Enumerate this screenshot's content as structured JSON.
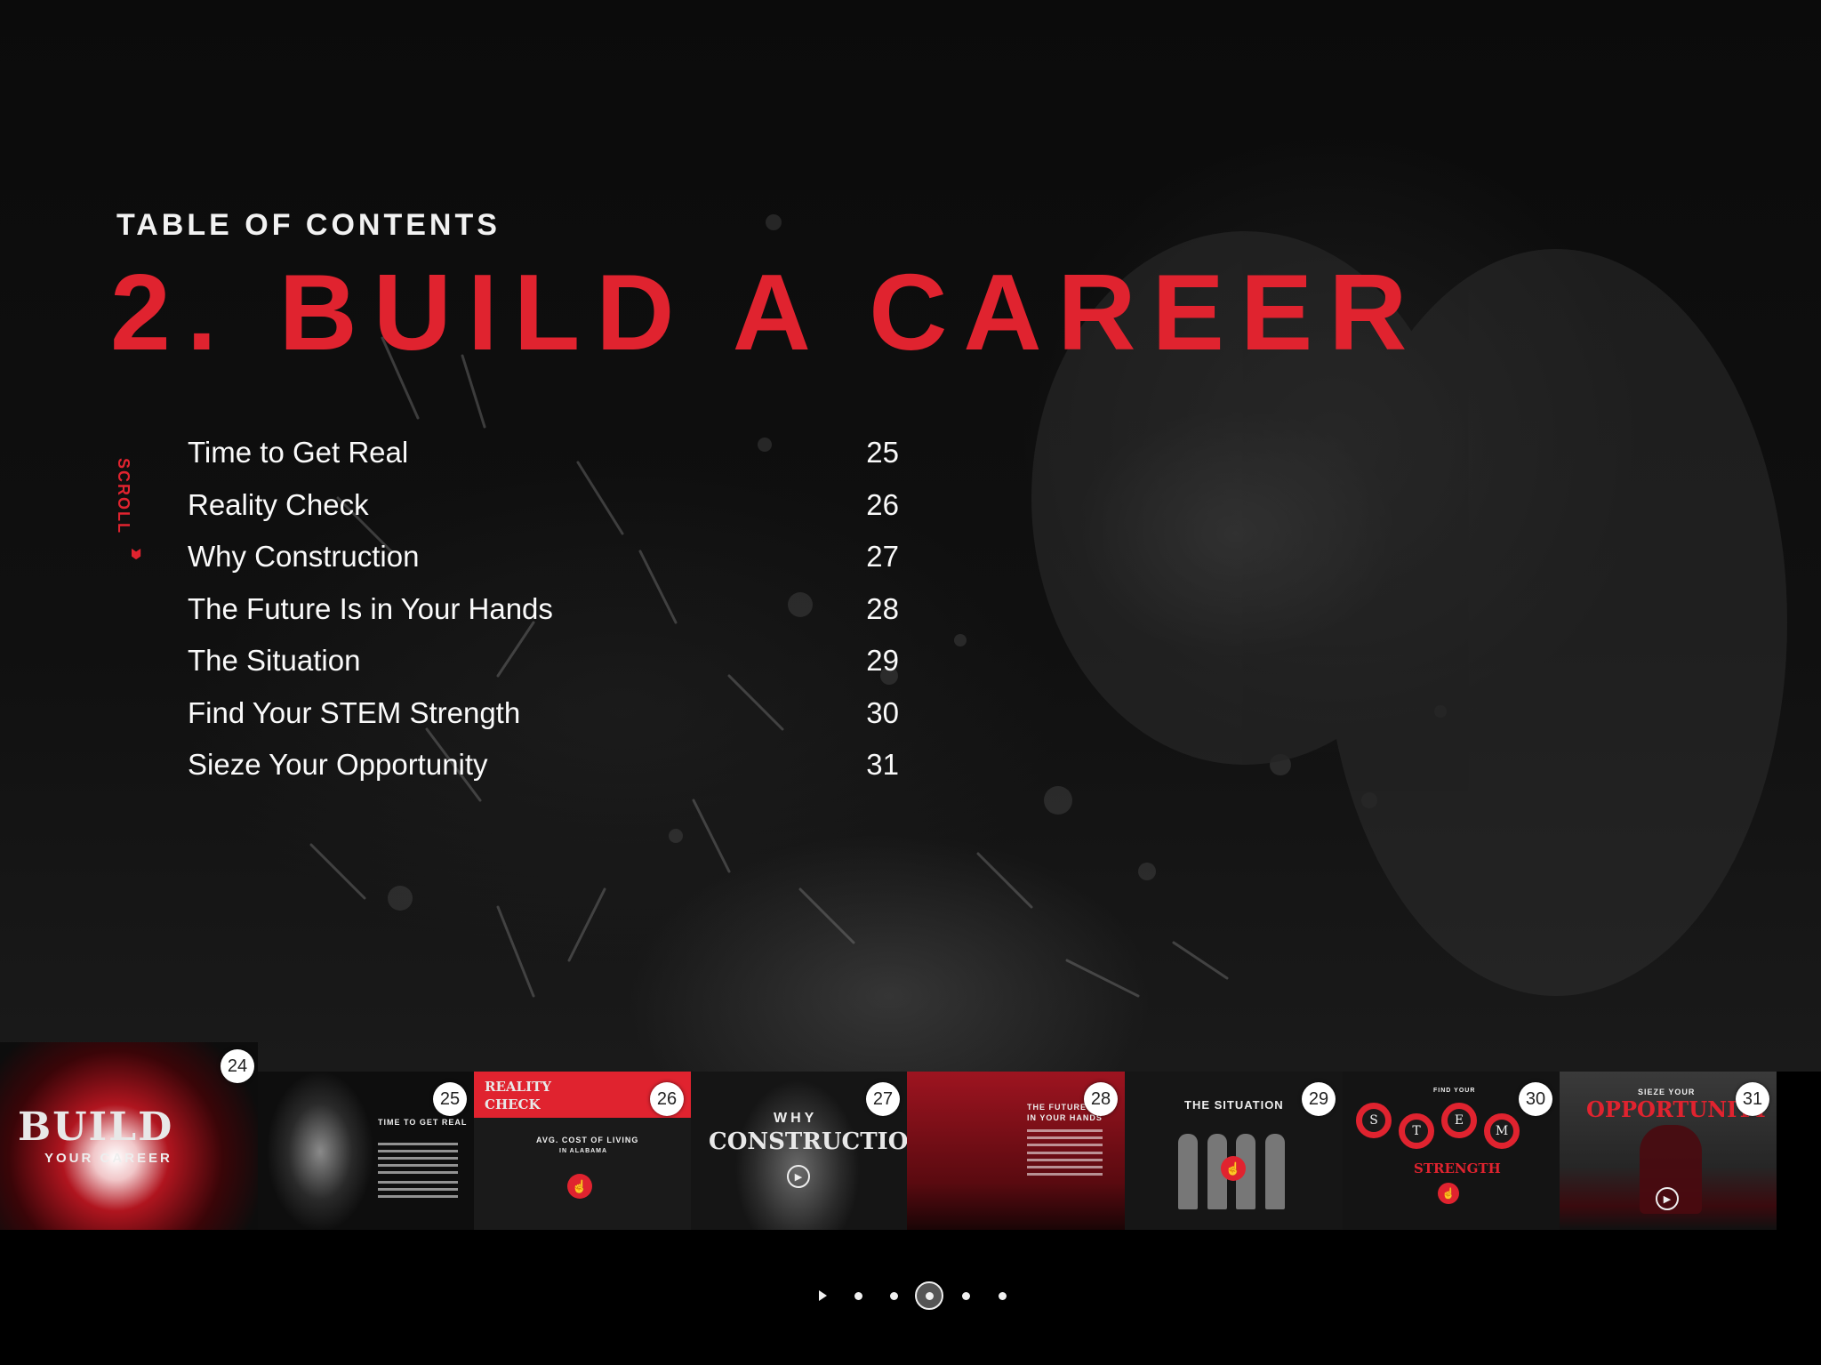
{
  "header": {
    "toc_label": "TABLE OF CONTENTS",
    "chapter_title": "2. BUILD A CAREER"
  },
  "scroll_hint": {
    "label": "SCROLL",
    "icon": "triple-chevron-down-icon"
  },
  "toc": {
    "items": [
      {
        "title": "Time to Get Real",
        "page": "25"
      },
      {
        "title": "Reality Check",
        "page": "26"
      },
      {
        "title": "Why Construction",
        "page": "27"
      },
      {
        "title": "The Future Is in Your Hands",
        "page": "28"
      },
      {
        "title": "The Situation",
        "page": "29"
      },
      {
        "title": "Find Your STEM Strength",
        "page": "30"
      },
      {
        "title": "Sieze Your Opportunity",
        "page": "31"
      }
    ]
  },
  "thumbnails": [
    {
      "page": "24",
      "title": "BUILD",
      "subtitle": "YOUR CAREER"
    },
    {
      "page": "25",
      "title": "TIME TO GET REAL"
    },
    {
      "page": "26",
      "title_line1": "REALITY",
      "title_line2": "CHECK",
      "widget_title": "AVG. COST OF LIVING",
      "widget_subtitle": "IN ALABAMA"
    },
    {
      "page": "27",
      "title_line1": "WHY",
      "title_line2": "CONSTRUCTION"
    },
    {
      "page": "28",
      "title_line1": "THE FUTURE IS",
      "title_line2": "IN YOUR HANDS"
    },
    {
      "page": "29",
      "title": "THE SITUATION"
    },
    {
      "page": "30",
      "kicker": "FIND YOUR",
      "letters": [
        "S",
        "T",
        "E",
        "M"
      ],
      "title": "STRENGTH"
    },
    {
      "page": "31",
      "kicker": "SIEZE YOUR",
      "title": "OPPORTUNITY"
    }
  ],
  "pager": {
    "total_dots": 5,
    "active_index": 2,
    "has_play": true
  },
  "colors": {
    "accent": "#e0232f",
    "text": "#fafafa",
    "background": "#0b0b0b"
  }
}
